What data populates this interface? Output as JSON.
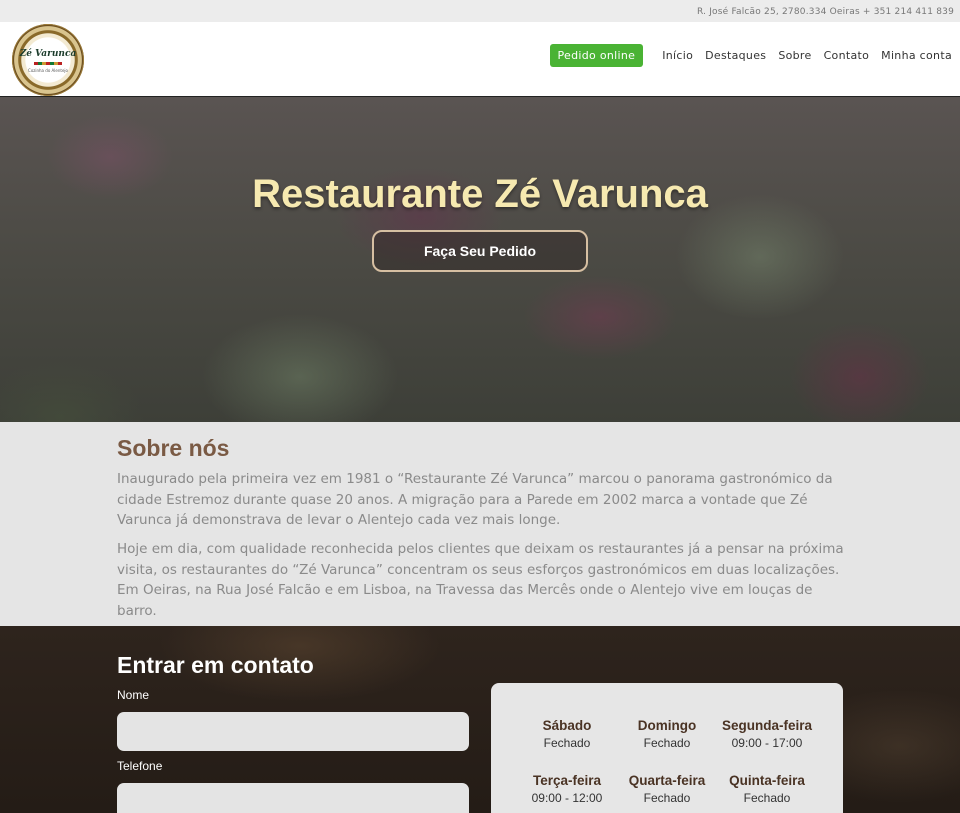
{
  "topbar": {
    "address": "R. José Falcão 25, 2780.334 Oeiras + 351 214 411 839"
  },
  "logo": {
    "name": "Zé Varunca",
    "subtitle": "Cozinha do Alentejo"
  },
  "nav": {
    "order_online": "Pedido online",
    "links": [
      "Início",
      "Destaques",
      "Sobre",
      "Contato",
      "Minha conta"
    ]
  },
  "hero": {
    "title": "Restaurante Zé Varunca",
    "button": "Faça Seu Pedido"
  },
  "about": {
    "title": "Sobre nós",
    "paragraphs": [
      "Inaugurado pela primeira vez em 1981 o “Restaurante Zé Varunca” marcou o panorama gastronómico da cidade Estremoz durante quase 20 anos. A migração para a Parede em 2002 marca a vontade que Zé Varunca já demonstrava de levar o Alentejo cada vez mais longe.",
      "Hoje em dia, com qualidade reconhecida pelos clientes que deixam os restaurantes já a pensar na próxima visita, os restaurantes do “Zé Varunca” concentram os seus esforços gastronómicos em duas localizações. Em Oeiras, na Rua José Falcão e em Lisboa, na Travessa das Mercês onde o Alentejo vive em louças de barro."
    ]
  },
  "contact": {
    "title": "Entrar em contato",
    "name_label": "Nome",
    "phone_label": "Telefone",
    "name_value": "",
    "phone_value": ""
  },
  "hours": [
    {
      "day": "Sábado",
      "time": "Fechado"
    },
    {
      "day": "Domingo",
      "time": "Fechado"
    },
    {
      "day": "Segunda-feira",
      "time": "09:00 - 17:00"
    },
    {
      "day": "Terça-feira",
      "time": "09:00 - 12:00"
    },
    {
      "day": "Quarta-feira",
      "time": "Fechado"
    },
    {
      "day": "Quinta-feira",
      "time": "Fechado"
    }
  ],
  "colors": {
    "accent_green": "#4ab334",
    "hero_title": "#f6e9b0",
    "heading_brown": "#7a5a44"
  }
}
